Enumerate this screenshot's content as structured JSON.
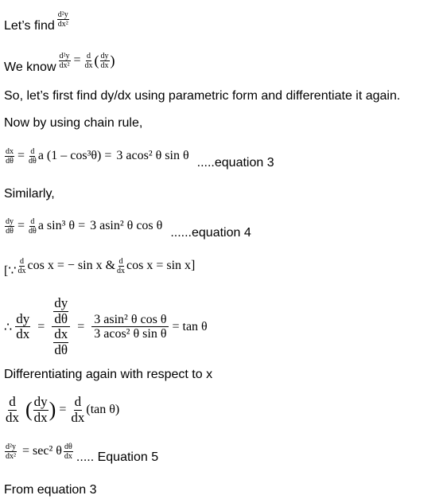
{
  "lines": {
    "l1_text": "Let’s find",
    "l2_text": "We know",
    "l3_text": "So, let’s first find dy/dx using parametric form and differentiate it again.",
    "l4_text": "Now by using chain rule,",
    "l6_text": "Similarly,",
    "l10_text": "Differentiating again with respect to x",
    "l13_text": "From equation 3"
  },
  "math": {
    "d2y": "d²y",
    "dx2": "dx²",
    "d": "d",
    "dx": "dx",
    "dy": "dy",
    "dtheta": "dθ",
    "eq": "=",
    "eq3_rhs1": "a (1 – cos³θ) =",
    "eq3_rhs2": "3 acos² θ sin  θ",
    "eq3_label": ".....equation 3",
    "eq4_rhs1": "a sin³ θ  =",
    "eq4_rhs2": "3 asin² θ cos θ",
    "eq4_label": "......equation 4",
    "because_open": "[∵",
    "cos_part1": "cos x = − sin x &",
    "cos_part2": "cos x = sin x]",
    "therefore": "∴",
    "num_big": "3 asin² θ cos θ",
    "den_big": "3 acos² θ sin  θ",
    "tan_result": "= tan θ",
    "paren_open": "(",
    "paren_close": ")",
    "tan_paren": "(tan θ)",
    "sec_part": "= sec² θ",
    "eq5_label": "..... Equation 5"
  }
}
